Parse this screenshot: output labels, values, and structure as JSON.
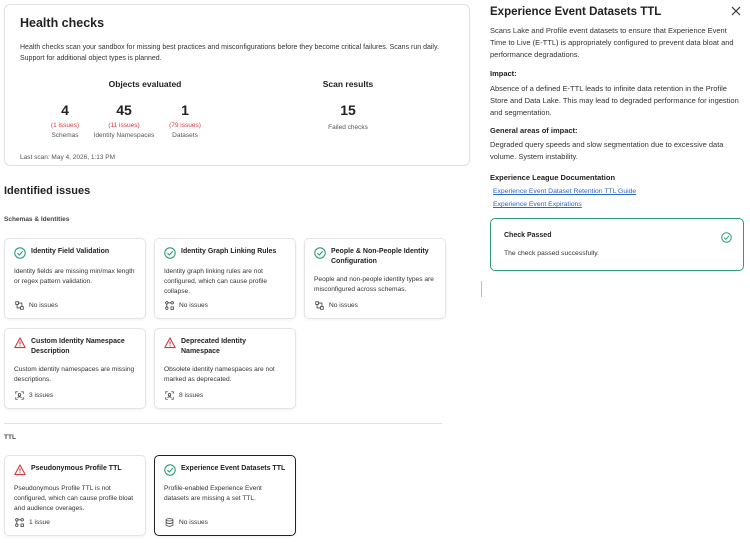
{
  "summary": {
    "title": "Health checks",
    "description": "Health checks scan your sandbox for missing best practices and misconfigurations before they become critical failures. Scans run daily. Support for additional object types is planned.",
    "objects_heading": "Objects evaluated",
    "results_heading": "Scan results",
    "stats": [
      {
        "value": "4",
        "issues": "(1 issues)",
        "label": "Schemas"
      },
      {
        "value": "45",
        "issues": "(11 issues)",
        "label": "Identity Namespaces"
      },
      {
        "value": "1",
        "issues": "(79 issues)",
        "label": "Datasets"
      }
    ],
    "failed": {
      "value": "15",
      "label": "Failed checks"
    },
    "last_scan": "Last scan: May 4, 2026, 1:13 PM"
  },
  "issues": {
    "title": "Identified issues",
    "group1": "Schemas & Identities",
    "group2": "TTL",
    "cards": [
      {
        "title": "Identity Field Validation",
        "body": "Identity fields are missing min/max length or regex pattern validation.",
        "footer": "No issues",
        "status": "pass",
        "footer_icon": "schema-icon"
      },
      {
        "title": "Identity Graph Linking Rules",
        "body": "Identity graph linking rules are not configured, which can cause profile collapse.",
        "footer": "No issues",
        "status": "pass",
        "footer_icon": "graph-icon"
      },
      {
        "title": "People & Non-People Identity Configuration",
        "body": "People and non-people identity types are misconfigured across schemas.",
        "footer": "No issues",
        "status": "pass",
        "footer_icon": "schema-icon"
      },
      {
        "title": "Custom Identity Namespace Description",
        "body": "Custom identity namespaces are missing descriptions.",
        "footer": "3 issues",
        "status": "warn",
        "footer_icon": "namespace-icon"
      },
      {
        "title": "Deprecated Identity Namespace",
        "body": "Obsolete identity namespaces are not marked as deprecated.",
        "footer": "8 issues",
        "status": "warn",
        "footer_icon": "namespace-icon"
      },
      {
        "title": "Pseudonymous Profile TTL",
        "body": "Pseudonymous Profile TTL is not configured, which can cause profile bloat and audience overages.",
        "footer": "1 issue",
        "status": "warn",
        "footer_icon": "graph-icon"
      },
      {
        "title": "Experience Event Datasets TTL",
        "body": "Profile-enabled Experience Event datasets are missing a set TTL.",
        "footer": "No issues",
        "status": "pass",
        "footer_icon": "database-icon"
      }
    ]
  },
  "panel": {
    "title": "Experience Event Datasets TTL",
    "intro": "Scans Lake and Profile event datasets to ensure that Experience Event Time to Live (E-TTL) is appropriately configured to prevent data bloat and performance degradations.",
    "impact_heading": "Impact:",
    "impact_text": "Absence of a defined E-TTL leads to infinite data retention in the Profile Store and Data Lake. This may lead to degraded performance for ingestion and segmentation.",
    "areas_heading": "General areas of impact:",
    "areas_text": "Degraded query speeds and slow segmentation due to excessive data volume. System instability.",
    "docs_heading": "Experience League Documentation",
    "links": [
      "Experience Event Dataset Retention TTL Guide",
      "Experience Event Expirations"
    ],
    "check": {
      "title": "Check Passed",
      "message": "The check passed successfully."
    }
  },
  "colors": {
    "pass": "#2d9d78",
    "warn": "#d7373f",
    "link": "#2a64c9"
  }
}
